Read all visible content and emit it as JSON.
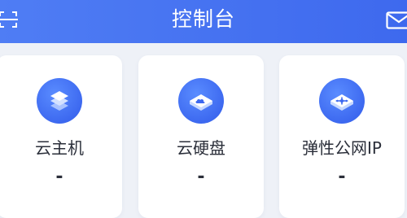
{
  "header": {
    "title": "控制台",
    "left_icon": "scan-icon",
    "right_icon": "mail-icon",
    "background": "#4174f0"
  },
  "cards": [
    {
      "label": "云主机",
      "value": "-",
      "icon": "server-stack-icon"
    },
    {
      "label": "云硬盘",
      "value": "-",
      "icon": "cloud-disk-icon"
    },
    {
      "label": "弹性公网IP",
      "value": "-",
      "icon": "elastic-ip-icon"
    }
  ],
  "colors": {
    "accent": "#3d69f0",
    "page_background": "#eef1f7",
    "card_background": "#ffffff",
    "text": "#2b2f3a"
  }
}
